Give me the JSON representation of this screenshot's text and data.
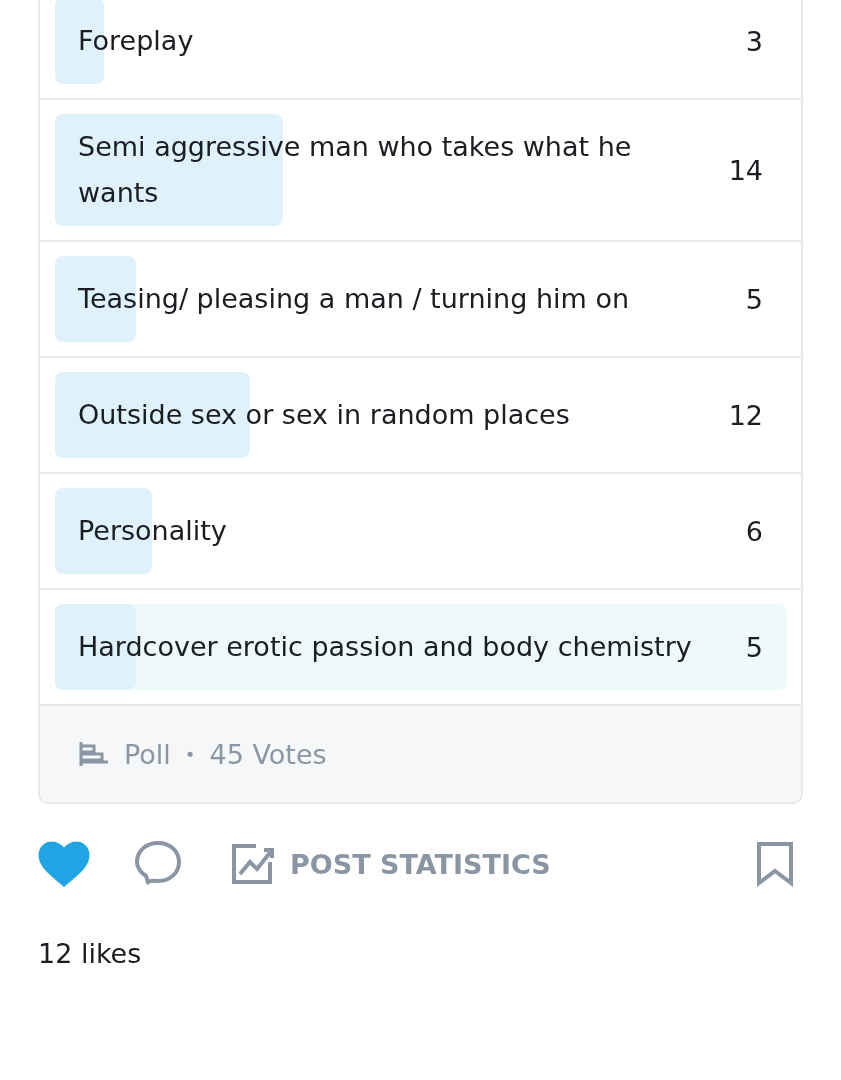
{
  "poll": {
    "options": [
      {
        "label": "Foreplay",
        "count": "3",
        "level": 0.067,
        "selected": false
      },
      {
        "label": "Semi aggressive man who takes what he wants",
        "count": "14",
        "level": 0.311,
        "selected": false
      },
      {
        "label": "Teasing/ pleasing a man / turning him on",
        "count": "5",
        "level": 0.111,
        "selected": false
      },
      {
        "label": "Outside sex or sex in random places",
        "count": "12",
        "level": 0.267,
        "selected": false
      },
      {
        "label": "Personality",
        "count": "6",
        "level": 0.133,
        "selected": false
      },
      {
        "label": "Hardcover erotic passion and body chemistry",
        "count": "5",
        "level": 0.111,
        "selected": true
      }
    ],
    "footer": {
      "type": "Poll",
      "separator": "•",
      "votes": "45 Votes"
    }
  },
  "actions": {
    "liked": true,
    "statistics": "POST STATISTICS"
  },
  "likes": "12 likes"
}
